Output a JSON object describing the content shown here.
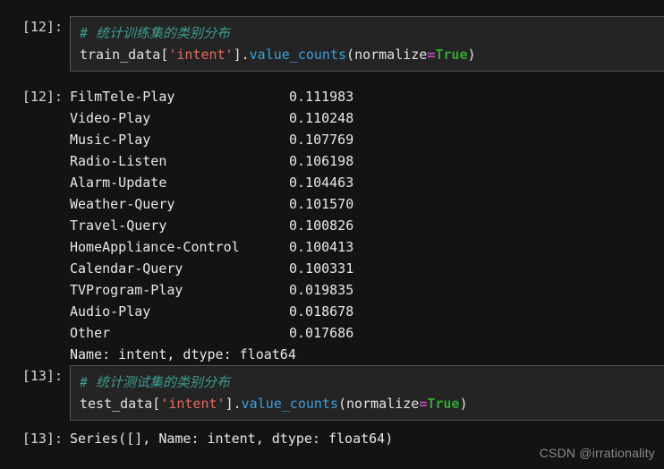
{
  "cells": [
    {
      "prompt": "[12]:",
      "type": "input",
      "comment": "# 统计训练集的类别分布",
      "code": {
        "var": "train_data",
        "bracket_open": "[",
        "string": "'intent'",
        "bracket_close": "]",
        "dot": ".",
        "func": "value_counts",
        "paren_open": "(",
        "kwarg": "normalize",
        "equals": "=",
        "value": "True",
        "paren_close": ")"
      }
    },
    {
      "prompt": "[12]:",
      "type": "output",
      "rows": [
        {
          "label": "FilmTele-Play",
          "value": "0.111983"
        },
        {
          "label": "Video-Play",
          "value": "0.110248"
        },
        {
          "label": "Music-Play",
          "value": "0.107769"
        },
        {
          "label": "Radio-Listen",
          "value": "0.106198"
        },
        {
          "label": "Alarm-Update",
          "value": "0.104463"
        },
        {
          "label": "Weather-Query",
          "value": "0.101570"
        },
        {
          "label": "Travel-Query",
          "value": "0.100826"
        },
        {
          "label": "HomeAppliance-Control",
          "value": "0.100413"
        },
        {
          "label": "Calendar-Query",
          "value": "0.100331"
        },
        {
          "label": "TVProgram-Play",
          "value": "0.019835"
        },
        {
          "label": "Audio-Play",
          "value": "0.018678"
        },
        {
          "label": "Other",
          "value": "0.017686"
        }
      ],
      "footer": "Name: intent, dtype: float64"
    },
    {
      "prompt": "[13]:",
      "type": "input",
      "comment": "# 统计测试集的类别分布",
      "code": {
        "var": "test_data",
        "bracket_open": "[",
        "string": "'intent'",
        "bracket_close": "]",
        "dot": ".",
        "func": "value_counts",
        "paren_open": "(",
        "kwarg": "normalize",
        "equals": "=",
        "value": "True",
        "paren_close": ")"
      }
    },
    {
      "prompt": "[13]:",
      "type": "output",
      "rows": [],
      "footer": "Series([], Name: intent, dtype: float64)"
    }
  ],
  "watermark": "CSDN @irrationality",
  "colors": {
    "page_background": "#131313",
    "cell_background": "#242424",
    "cell_border": "#535353",
    "comment": "#3d9c8f",
    "string": "#e06c60",
    "function": "#3a9fe0",
    "operator": "#c050c0",
    "keyword": "#33a533",
    "text": "#e2e2e2",
    "prompt": "#d6d6d6",
    "watermark": "#8a8a8a"
  }
}
